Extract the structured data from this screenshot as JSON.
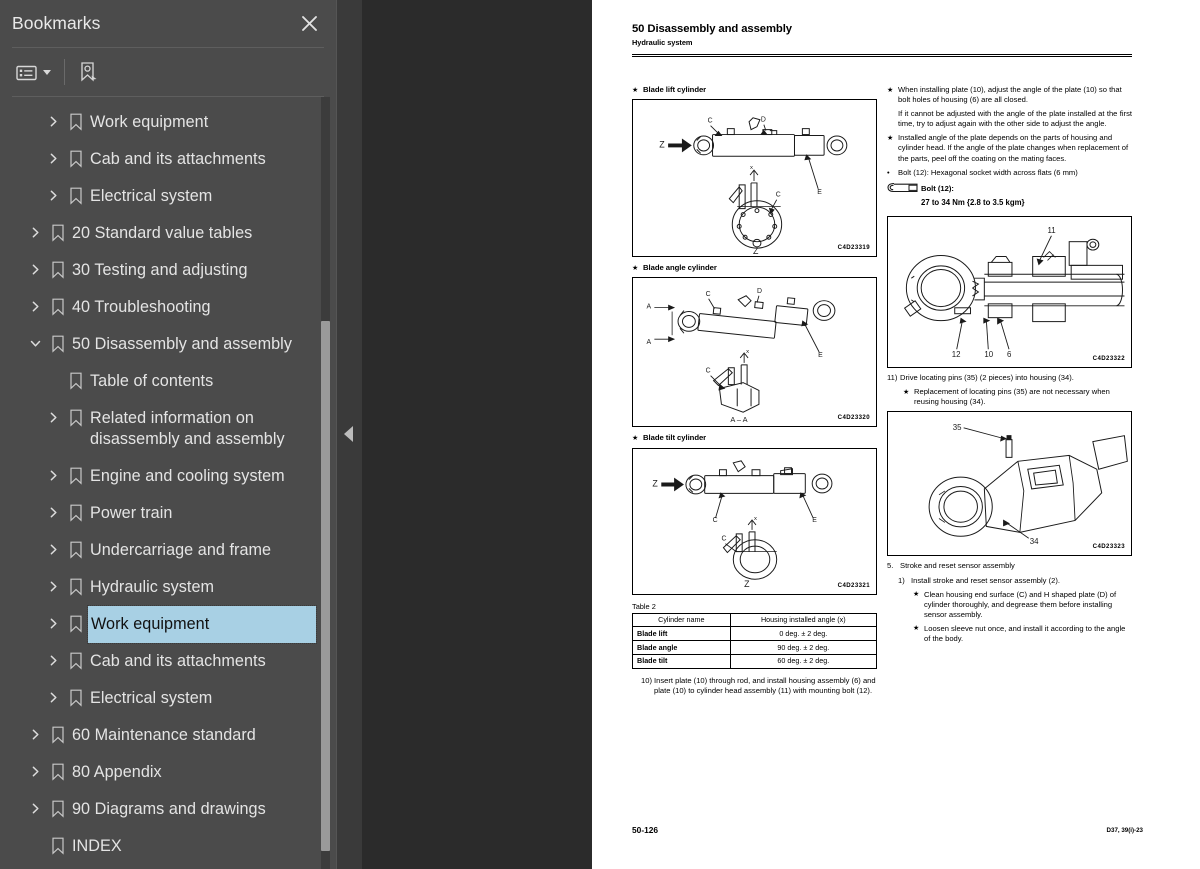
{
  "sidebar": {
    "title": "Bookmarks",
    "close_icon": "close-icon",
    "toolbar": {
      "list_options_icon": "list-options-icon",
      "caret_icon": "chevron-down-icon",
      "new_bookmark_icon": "new-bookmark-icon"
    },
    "tree": [
      {
        "label": "Work equipment",
        "depth": 2,
        "twisty": "collapsed",
        "selected": false
      },
      {
        "label": "Cab and its attachments",
        "depth": 2,
        "twisty": "collapsed",
        "selected": false
      },
      {
        "label": "Electrical system",
        "depth": 2,
        "twisty": "collapsed",
        "selected": false
      },
      {
        "label": "20 Standard value tables",
        "depth": 1,
        "twisty": "collapsed",
        "selected": false
      },
      {
        "label": "30 Testing and adjusting",
        "depth": 1,
        "twisty": "collapsed",
        "selected": false
      },
      {
        "label": "40 Troubleshooting",
        "depth": 1,
        "twisty": "collapsed",
        "selected": false
      },
      {
        "label": "50 Disassembly and assembly",
        "depth": 1,
        "twisty": "expanded",
        "selected": false
      },
      {
        "label": "Table of contents",
        "depth": 2,
        "twisty": "none",
        "selected": false
      },
      {
        "label": "Related information on\ndisassembly and assembly",
        "depth": 2,
        "twisty": "collapsed",
        "selected": false
      },
      {
        "label": "Engine and cooling system",
        "depth": 2,
        "twisty": "collapsed",
        "selected": false
      },
      {
        "label": "Power train",
        "depth": 2,
        "twisty": "collapsed",
        "selected": false
      },
      {
        "label": "Undercarriage and frame",
        "depth": 2,
        "twisty": "collapsed",
        "selected": false
      },
      {
        "label": "Hydraulic system",
        "depth": 2,
        "twisty": "collapsed",
        "selected": false
      },
      {
        "label": "Work equipment",
        "depth": 2,
        "twisty": "collapsed",
        "selected": true
      },
      {
        "label": "Cab and its attachments",
        "depth": 2,
        "twisty": "collapsed",
        "selected": false
      },
      {
        "label": "Electrical system",
        "depth": 2,
        "twisty": "collapsed",
        "selected": false
      },
      {
        "label": "60 Maintenance standard",
        "depth": 1,
        "twisty": "collapsed",
        "selected": false
      },
      {
        "label": "80 Appendix",
        "depth": 1,
        "twisty": "collapsed",
        "selected": false
      },
      {
        "label": "90 Diagrams and drawings",
        "depth": 1,
        "twisty": "collapsed",
        "selected": false
      },
      {
        "label": "INDEX",
        "depth": 1,
        "twisty": "none",
        "selected": false
      }
    ]
  },
  "panel_divider": {
    "collapse_icon": "collapse-left-arrow-icon"
  },
  "page": {
    "header_title": "50 Disassembly and assembly",
    "header_subtitle": "Hydraulic system",
    "footer_left": "50-126",
    "footer_right": "D37, 39(i)-23",
    "left_column": {
      "fig1_caption": "Blade lift cylinder",
      "fig1_id": "C4D23319",
      "fig2_caption": "Blade angle cylinder",
      "fig2_id": "C4D23320",
      "fig3_caption": "Blade tilt cylinder",
      "fig3_id": "C4D23321",
      "table_title": "Table 2",
      "table_headers": [
        "Cylinder name",
        "Housing installed angle (x)"
      ],
      "table_rows": [
        [
          "Blade lift",
          "0 deg. ± 2 deg."
        ],
        [
          "Blade angle",
          "90 deg. ± 2 deg."
        ],
        [
          "Blade tilt",
          "60 deg. ± 2 deg."
        ]
      ],
      "step10_num": "10)",
      "step10_text": "Insert plate (10) through rod, and install housing assembly (6) and plate (10) to cylinder head assembly (11) with mounting bolt (12)."
    },
    "right_column": {
      "note1": "When installing plate (10), adjust the angle of the plate (10) so that bolt holes of housing (6) are all closed.",
      "note1b": "If it cannot be adjusted with the angle of the plate installed at the first time, try to adjust again with the other side to adjust the angle.",
      "note2": "Installed angle of the plate depends on the parts of housing and cylinder head. If the angle of the plate changes when replacement of the parts, peel off the coating on the mating faces.",
      "bullet1": "Bolt (12): Hexagonal socket width across flats (6 mm)",
      "torque_label": "Bolt (12):",
      "torque_value": "27 to 34 Nm {2.8 to 3.5 kgm}",
      "fig4_id": "C4D23322",
      "fig4_callouts": [
        "11",
        "12",
        "10",
        "6"
      ],
      "step11_num": "11)",
      "step11_text": "Drive locating pins (35) (2 pieces) into housing (34).",
      "step11_note": "Replacement of locating pins (35) are not necessary when reusing housing (34).",
      "fig5_id": "C4D23323",
      "fig5_callouts": [
        "35",
        "34"
      ],
      "step5_num": "5.",
      "step5_text": "Stroke and reset sensor assembly",
      "step5_1_num": "1)",
      "step5_1_text": "Install stroke and reset sensor assembly (2).",
      "step5_note1": "Clean housing end surface (C) and H shaped plate (D) of cylinder thoroughly, and degrease them before installing sensor assembly.",
      "step5_note2": "Loosen sleeve nut once, and install it according to the angle of the body."
    }
  }
}
